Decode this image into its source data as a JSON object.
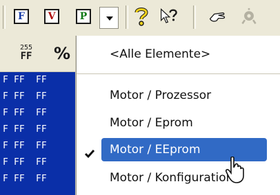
{
  "toolbar": {
    "btn_f": "F",
    "btn_v": "V",
    "btn_p": "P",
    "colors": {
      "f": "#1a3ea8",
      "v": "#b01010",
      "p": "#117a17"
    }
  },
  "side_toolbar": {
    "icon_num": "255",
    "icon_ff": "FF",
    "percent": "%"
  },
  "hex_rows": [
    [
      "F",
      "FF",
      "FF"
    ],
    [
      "F",
      "FF",
      "FF"
    ],
    [
      "F",
      "FF",
      "FF"
    ],
    [
      "F",
      "FF",
      "FF"
    ],
    [
      "F",
      "FF",
      "FF"
    ],
    [
      "F",
      "FF",
      "FF"
    ],
    [
      "F",
      "FF",
      "FF"
    ]
  ],
  "menu": {
    "all_elements": "<Alle Elemente>",
    "items": [
      {
        "label": "Motor / Prozessor"
      },
      {
        "label": "Motor / Eprom"
      },
      {
        "label": "Motor / EEprom",
        "checked": true
      },
      {
        "label": "Motor / Konfiguration"
      }
    ]
  }
}
